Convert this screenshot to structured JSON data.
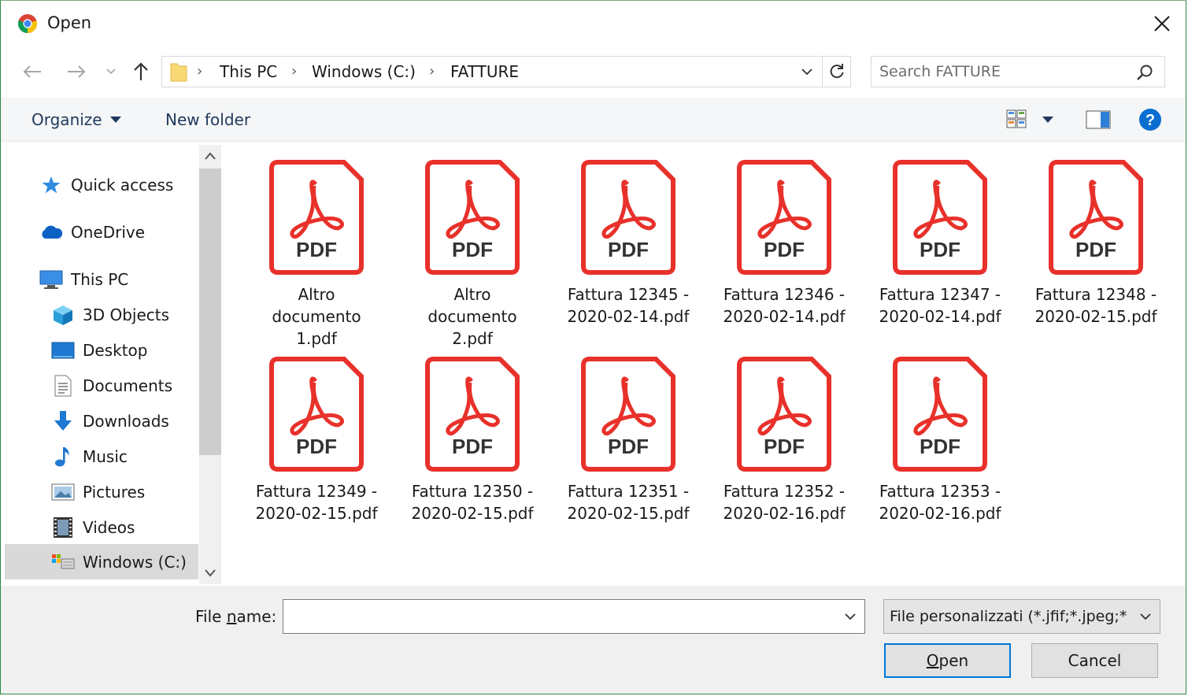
{
  "window": {
    "title": "Open",
    "app_icon": "chrome-icon",
    "close_icon": "close-icon"
  },
  "nav": {
    "back_icon": "arrow-left-icon",
    "forward_icon": "arrow-right-icon",
    "recent_icon": "chevron-down-icon",
    "up_icon": "arrow-up-icon",
    "breadcrumb": [
      "This PC",
      "Windows (C:)",
      "FATTURE"
    ],
    "refresh_icon": "refresh-icon"
  },
  "search": {
    "placeholder": "Search FATTURE",
    "icon": "search-icon"
  },
  "toolbar": {
    "organize_label": "Organize",
    "new_folder_label": "New folder",
    "view_icon": "large-icons-view-icon",
    "preview_icon": "preview-pane-icon",
    "help_icon": "help-icon"
  },
  "sidebar": {
    "items": [
      {
        "label": "Quick access",
        "icon": "star-icon"
      },
      {
        "label": "OneDrive",
        "icon": "cloud-icon"
      },
      {
        "label": "This PC",
        "icon": "computer-icon"
      },
      {
        "label": "3D Objects",
        "icon": "cube-icon"
      },
      {
        "label": "Desktop",
        "icon": "desktop-icon"
      },
      {
        "label": "Documents",
        "icon": "document-icon"
      },
      {
        "label": "Downloads",
        "icon": "download-icon"
      },
      {
        "label": "Music",
        "icon": "music-icon"
      },
      {
        "label": "Pictures",
        "icon": "pictures-icon"
      },
      {
        "label": "Videos",
        "icon": "video-icon"
      },
      {
        "label": "Windows (C:)",
        "icon": "drive-icon",
        "selected": true
      }
    ]
  },
  "files": [
    {
      "line1": "Altro",
      "line2": "documento",
      "line3": "1.pdf"
    },
    {
      "line1": "Altro",
      "line2": "documento",
      "line3": "2.pdf"
    },
    {
      "line1": "Fattura 12345 -",
      "line2": "2020-02-14.pdf",
      "line3": ""
    },
    {
      "line1": "Fattura 12346 -",
      "line2": "2020-02-14.pdf",
      "line3": ""
    },
    {
      "line1": "Fattura 12347 -",
      "line2": "2020-02-14.pdf",
      "line3": ""
    },
    {
      "line1": "Fattura 12348 -",
      "line2": "2020-02-15.pdf",
      "line3": ""
    },
    {
      "line1": "Fattura 12349 -",
      "line2": "2020-02-15.pdf",
      "line3": ""
    },
    {
      "line1": "Fattura 12350 -",
      "line2": "2020-02-15.pdf",
      "line3": ""
    },
    {
      "line1": "Fattura 12351 -",
      "line2": "2020-02-15.pdf",
      "line3": ""
    },
    {
      "line1": "Fattura 12352 -",
      "line2": "2020-02-16.pdf",
      "line3": ""
    },
    {
      "line1": "Fattura 12353 -",
      "line2": "2020-02-16.pdf",
      "line3": ""
    }
  ],
  "pdf_icon_label": "PDF",
  "footer": {
    "file_name_label_pre": "File ",
    "file_name_label_underlined": "n",
    "file_name_label_post": "ame:",
    "file_name_value": "",
    "filter_value": "File personalizzati (*.jfif;*.jpeg;*",
    "open_underlined": "O",
    "open_rest": "pen",
    "cancel_label": "Cancel"
  },
  "colors": {
    "pdf_red": "#e8312a",
    "accent": "#0078d7",
    "help_blue": "#0a6ed1"
  }
}
